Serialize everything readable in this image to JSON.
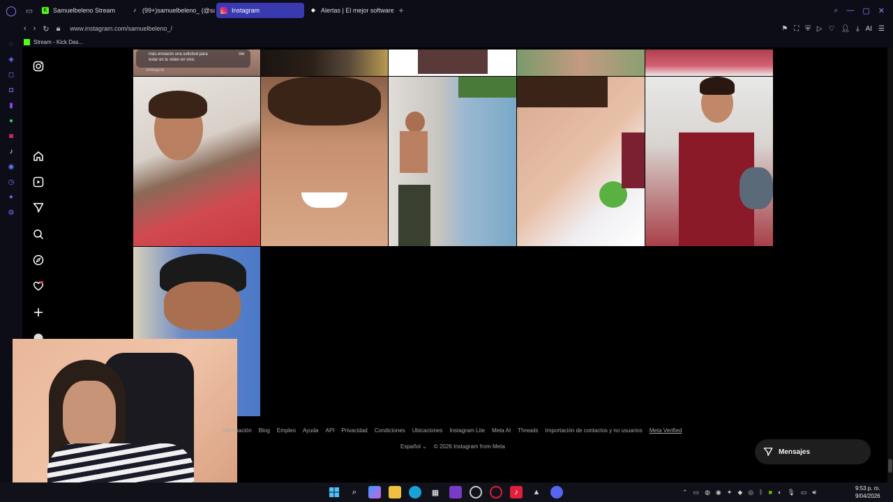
{
  "tabs": [
    {
      "label": "Samuelbeleno Stream",
      "icon": "kick-icon",
      "color": "#53fc18"
    },
    {
      "label": "(99+)samuelbeleno_ (@sa",
      "icon": "tiktok-icon",
      "color": "#ffffff"
    },
    {
      "label": "Instagram",
      "icon": "instagram-icon",
      "color": "#e1306c",
      "active": true
    },
    {
      "label": "Alertas | El mejor software",
      "icon": "alert-icon",
      "color": "#ffffff"
    }
  ],
  "address": {
    "url": "www.instagram.com/samuelbeleno_/"
  },
  "address_ai": "AI",
  "bookmark": {
    "label": "Stream - Kick Das..."
  },
  "footer": {
    "links": [
      "Información",
      "Blog",
      "Empleo",
      "Ayuda",
      "API",
      "Privacidad",
      "Condiciones",
      "Ubicaciones",
      "Instagram Lite",
      "Meta AI",
      "Threads",
      "Importación de contactos y no usuarios",
      "Meta Verified"
    ],
    "language": "Español",
    "copyright": "© 2026 Instagram from Meta"
  },
  "messages_button": {
    "label": "Mensajes"
  },
  "story_overlay": {
    "line1": "más enviaron una solicitud para",
    "line2": "estar en tu video en vivo.",
    "action": "Ver",
    "user": "mrbegura"
  },
  "clock": {
    "time": "9:53 p. m.",
    "date": "9/04/2026"
  },
  "colors": {
    "accent": "#3a3ab0",
    "kick": "#53fc18",
    "notification": "#ff3040"
  }
}
